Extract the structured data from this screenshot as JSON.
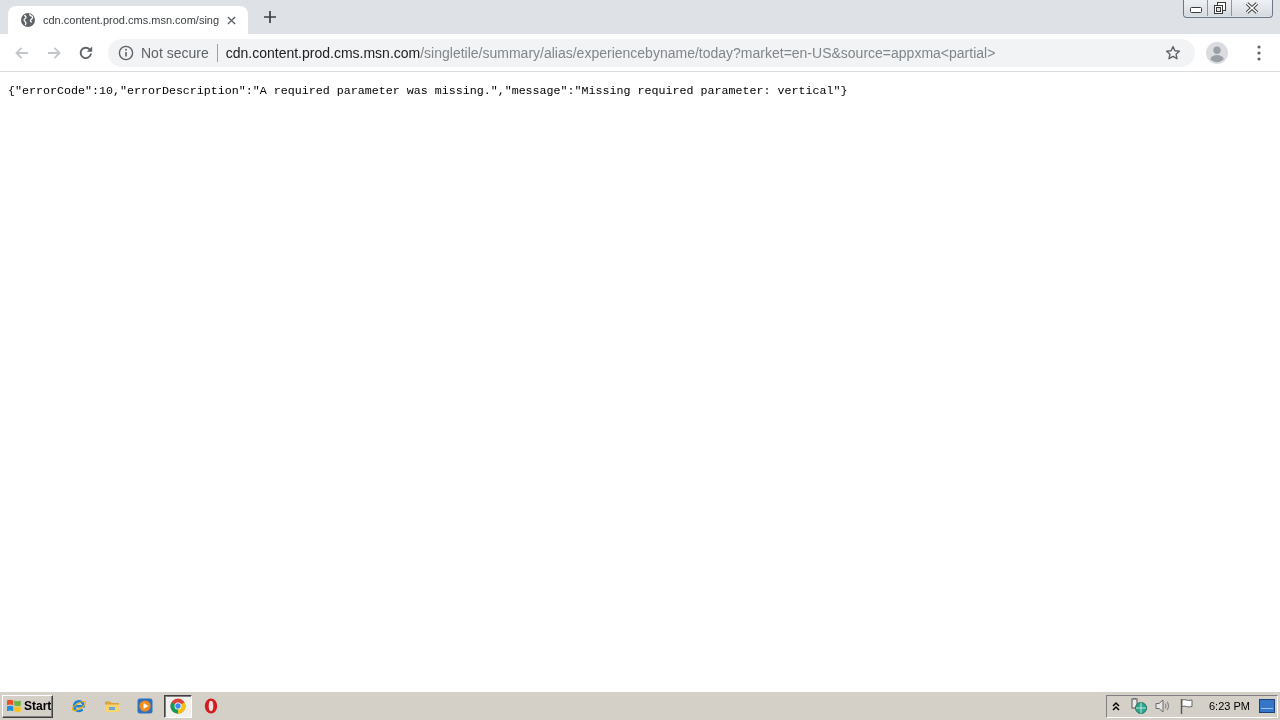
{
  "browser": {
    "tabs": [
      {
        "title": "cdn.content.prod.cms.msn.com/sing",
        "selected": true
      }
    ]
  },
  "toolbar": {
    "nav_buttons": [
      {
        "kind": "back",
        "disabled": true
      },
      {
        "kind": "forward",
        "disabled": true
      },
      {
        "kind": "reload",
        "disabled": false
      }
    ],
    "address_bar": {
      "security_label": "Not secure",
      "url_host": "cdn.content.prod.cms.msn.com",
      "url_path": "/singletile/summary/alias/experiencebyname/today?market=en-US&source=appxma<partial>"
    }
  },
  "page": {
    "body_text": "{\"errorCode\":10,\"errorDescription\":\"A required parameter was missing.\",\"message\":\"Missing required parameter: vertical\"}"
  },
  "taskbar": {
    "start_label": "Start",
    "apps": [
      {
        "kind": "ie",
        "selected": false
      },
      {
        "kind": "explorer",
        "selected": false
      },
      {
        "kind": "media_player",
        "selected": false
      },
      {
        "kind": "chrome",
        "selected": true
      },
      {
        "kind": "opera",
        "selected": false
      }
    ],
    "clock": "6:23 PM"
  }
}
